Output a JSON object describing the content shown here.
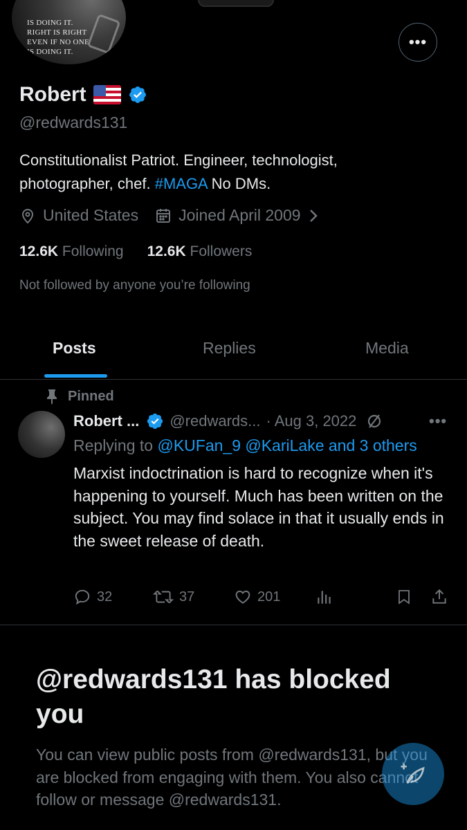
{
  "profile": {
    "avatar_quote": [
      "IS DOING IT.",
      "RIGHT IS RIGHT",
      "EVEN IF NO ONE",
      "IS DOING IT."
    ],
    "name": "Robert",
    "handle": "@redwards131",
    "bio_text": "Constitutionalist Patriot.  Engineer, technologist, photographer, chef. ",
    "bio_hashtag": "#MAGA",
    "bio_end": " No DMs.",
    "location": "United States",
    "joined": "Joined April 2009",
    "following_count": "12.6K",
    "following_label": "Following",
    "followers_count": "12.6K",
    "followers_label": "Followers",
    "not_followed": "Not followed by anyone you’re following"
  },
  "tabs": [
    {
      "label": "Posts",
      "active": true
    },
    {
      "label": "Replies",
      "active": false
    },
    {
      "label": "Media",
      "active": false
    }
  ],
  "pinned_post": {
    "pinned_label": "Pinned",
    "author": "Robert ...",
    "handle": "@redwards...",
    "date": "· Aug 3, 2022",
    "reply_prefix": "Replying to",
    "reply_mentions": "@KUFan_9 @KariLake and 3 others",
    "text": "Marxist indoctrination is hard to recognize when it's happening to yourself. Much has been written on the subject. You may find solace in that it usually ends in the sweet release of death.",
    "replies": "32",
    "reposts": "37",
    "likes": "201"
  },
  "blocked": {
    "title": "@redwards131 has blocked you",
    "text": "You can view public posts from @redwards131, but you are blocked from engaging with them. You also cannot follow or message @redwards131."
  },
  "colors": {
    "accent": "#1d9bf0",
    "muted": "#71767b",
    "text": "#e7e9ea",
    "background": "#000000"
  },
  "icons": [
    "more-icon",
    "verified-icon",
    "flag-icon",
    "location-icon",
    "calendar-icon",
    "chevron-right-icon",
    "pin-icon",
    "no-edit-icon",
    "reply-icon",
    "repost-icon",
    "like-icon",
    "views-icon",
    "bookmark-icon",
    "share-icon",
    "compose-icon"
  ]
}
